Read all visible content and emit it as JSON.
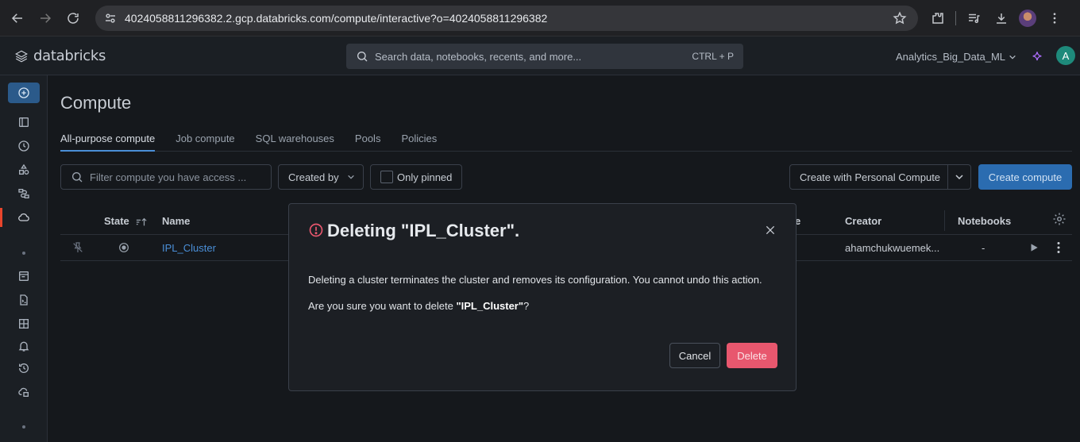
{
  "browser": {
    "url": "4024058811296382.2.gcp.databricks.com/compute/interactive?o=4024058811296382"
  },
  "header": {
    "logo_text": "databricks",
    "search_placeholder": "Search data, notebooks, recents, and more...",
    "search_shortcut": "CTRL + P",
    "workspace_name": "Analytics_Big_Data_ML",
    "user_initial": "A"
  },
  "page": {
    "title": "Compute",
    "tabs": [
      "All-purpose compute",
      "Job compute",
      "SQL warehouses",
      "Pools",
      "Policies"
    ],
    "active_tab": "All-purpose compute"
  },
  "filters": {
    "search_placeholder": "Filter compute you have access ...",
    "created_by_label": "Created by",
    "only_pinned_label": "Only pinned",
    "personal_compute_label": "Create with Personal Compute",
    "create_compute_label": "Create compute"
  },
  "table": {
    "columns": {
      "state": "State",
      "name": "Name",
      "runtime_tail": "e",
      "creator": "Creator",
      "notebooks": "Notebooks"
    },
    "rows": [
      {
        "name": "IPL_Cluster",
        "creator": "ahamchukwuemek...",
        "notebooks": "-"
      }
    ]
  },
  "modal": {
    "title": "Deleting \"IPL_Cluster\".",
    "body_1": "Deleting a cluster terminates the cluster and removes its configuration. You cannot undo this action.",
    "body_2_prefix": "Are you sure you want to delete ",
    "body_2_name": "\"IPL_Cluster\"",
    "body_2_suffix": "?",
    "cancel_label": "Cancel",
    "delete_label": "Delete"
  },
  "colors": {
    "accent_blue": "#2b6cb0",
    "danger": "#e8576e",
    "sidebar_active": "#e8452c"
  }
}
